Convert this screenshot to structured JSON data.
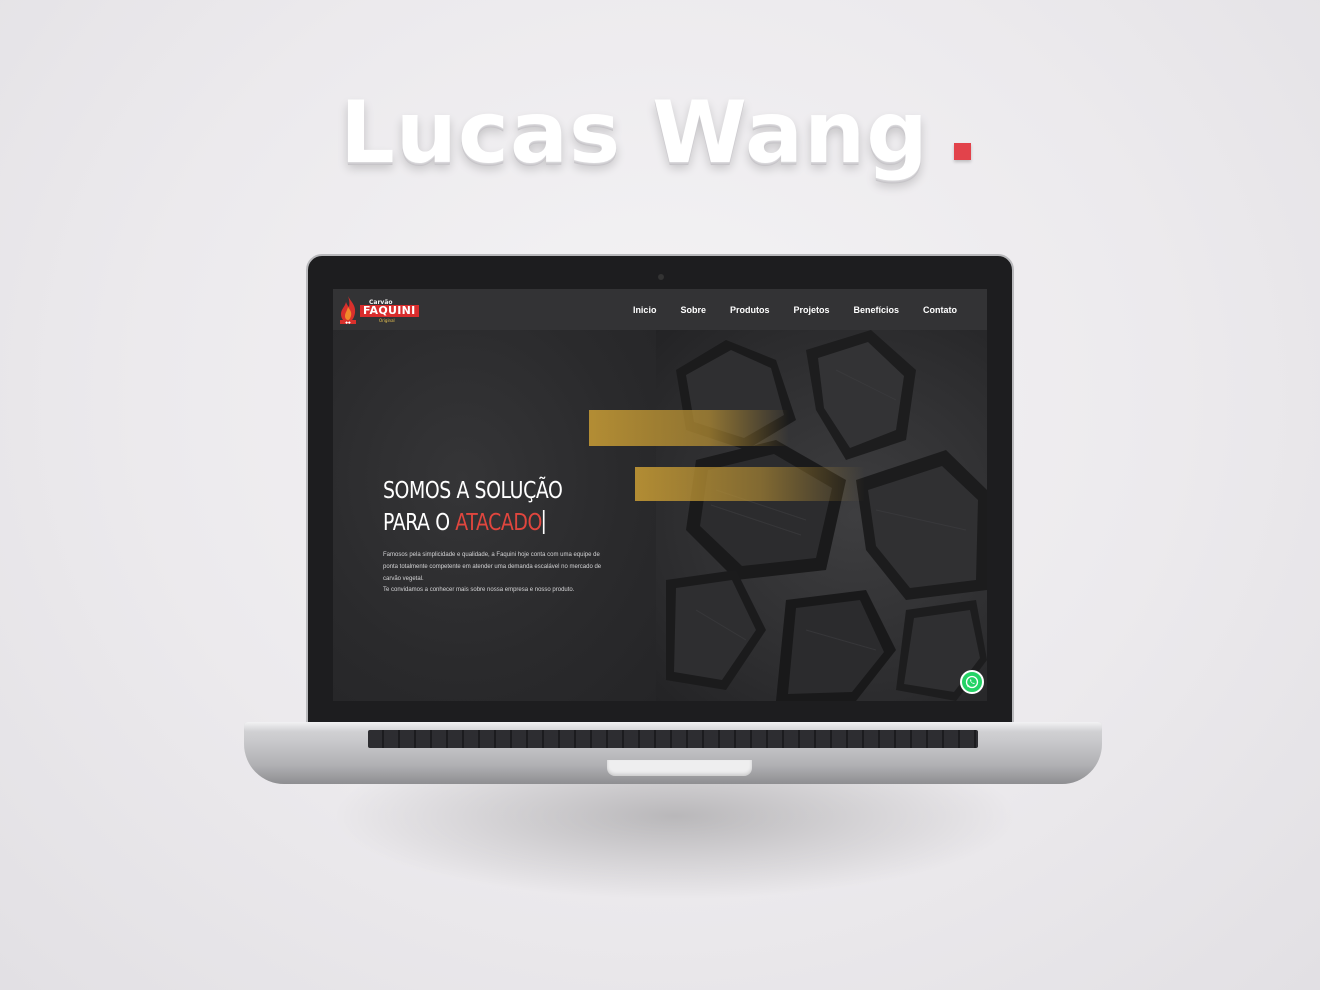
{
  "page": {
    "title_text": "Lucas Wang",
    "accent_color": "#e2434b"
  },
  "website": {
    "logo": {
      "small": "Carvão",
      "main": "FAQUINI",
      "sub": "Original"
    },
    "nav": {
      "items": [
        {
          "label": "Inicio"
        },
        {
          "label": "Sobre"
        },
        {
          "label": "Produtos"
        },
        {
          "label": "Projetos"
        },
        {
          "label": "Benefícios"
        },
        {
          "label": "Contato"
        }
      ]
    },
    "hero": {
      "title_line1": "SOMOS A SOLUÇÃO",
      "title_line2_prefix": "PARA O ",
      "title_line2_accent": "ATACADO",
      "paragraph": "Famosos pela simplicidade e qualidade, a Faquini hoje conta com uma equipe de ponta totalmente competente em atender uma demanda escalável no mercado de carvão vegetal.",
      "paragraph2": "Te convidamos a conhecer mais sobre nossa empresa e nosso produto.",
      "accent_color": "#e0463e",
      "gold_color": "#ba9234"
    },
    "floating": {
      "whatsapp_icon": "whatsapp-icon"
    }
  }
}
